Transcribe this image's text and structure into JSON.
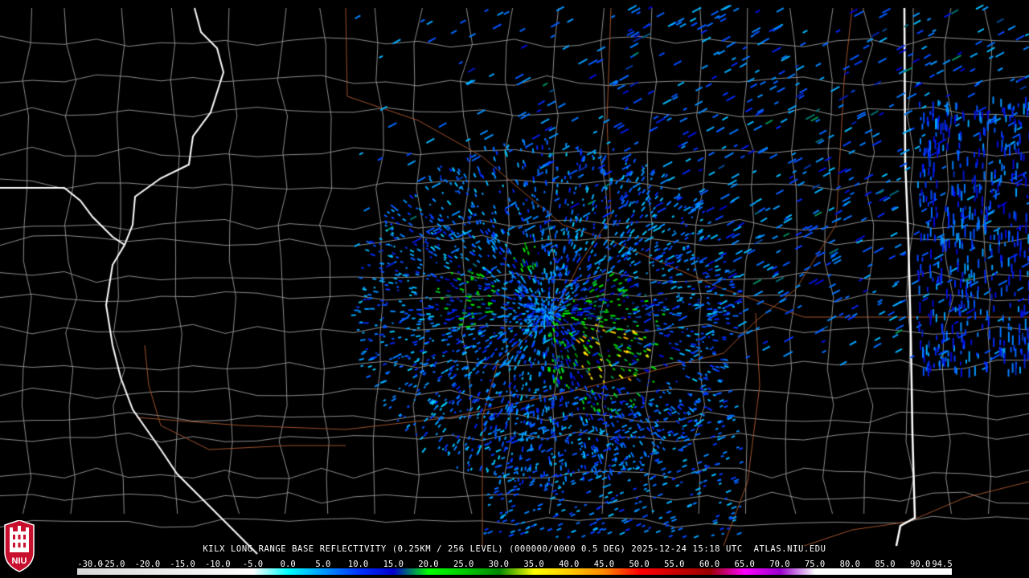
{
  "product": {
    "title": "KILX LONG RANGE BASE REFLECTIVITY (0.25KM / 256 LEVEL) (000000/0000 0.5 DEG) 2025-12-24 15:18 UTC  ATLAS.NIU.EDU",
    "logo_text": "NIU"
  },
  "color_scale": {
    "labels": [
      "-30.0",
      "-25.0",
      "-20.0",
      "-15.0",
      "-10.0",
      "-5.0",
      "0.0",
      "5.0",
      "10.0",
      "15.0",
      "20.0",
      "25.0",
      "30.0",
      "35.0",
      "40.0",
      "45.0",
      "50.0",
      "55.0",
      "60.0",
      "65.0",
      "70.0",
      "75.0",
      "80.0",
      "85.0",
      "90.0",
      "94.5"
    ],
    "min_dbz": -30.0,
    "max_dbz": 94.5,
    "stops": [
      {
        "dbz": -30,
        "color": "#d8d8d8"
      },
      {
        "dbz": -5,
        "color": "#ffffff"
      },
      {
        "dbz": 0,
        "color": "#00ffff"
      },
      {
        "dbz": 5,
        "color": "#0099ff"
      },
      {
        "dbz": 10,
        "color": "#0033ff"
      },
      {
        "dbz": 15,
        "color": "#0000cc"
      },
      {
        "dbz": 20,
        "color": "#00ff00"
      },
      {
        "dbz": 25,
        "color": "#00cc00"
      },
      {
        "dbz": 30,
        "color": "#008800"
      },
      {
        "dbz": 35,
        "color": "#ffff00"
      },
      {
        "dbz": 40,
        "color": "#ffcc00"
      },
      {
        "dbz": 45,
        "color": "#ff8800"
      },
      {
        "dbz": 50,
        "color": "#ff0000"
      },
      {
        "dbz": 55,
        "color": "#cc0000"
      },
      {
        "dbz": 60,
        "color": "#990000"
      },
      {
        "dbz": 65,
        "color": "#ff00ff"
      },
      {
        "dbz": 70,
        "color": "#9900cc"
      },
      {
        "dbz": 75,
        "color": "#ffffff"
      },
      {
        "dbz": 94.5,
        "color": "#ffffff"
      }
    ]
  },
  "map_colors": {
    "background": "#000000",
    "state_border": "#ffffff",
    "county_border": "#8c8c8c",
    "highway": "#a0522d"
  }
}
